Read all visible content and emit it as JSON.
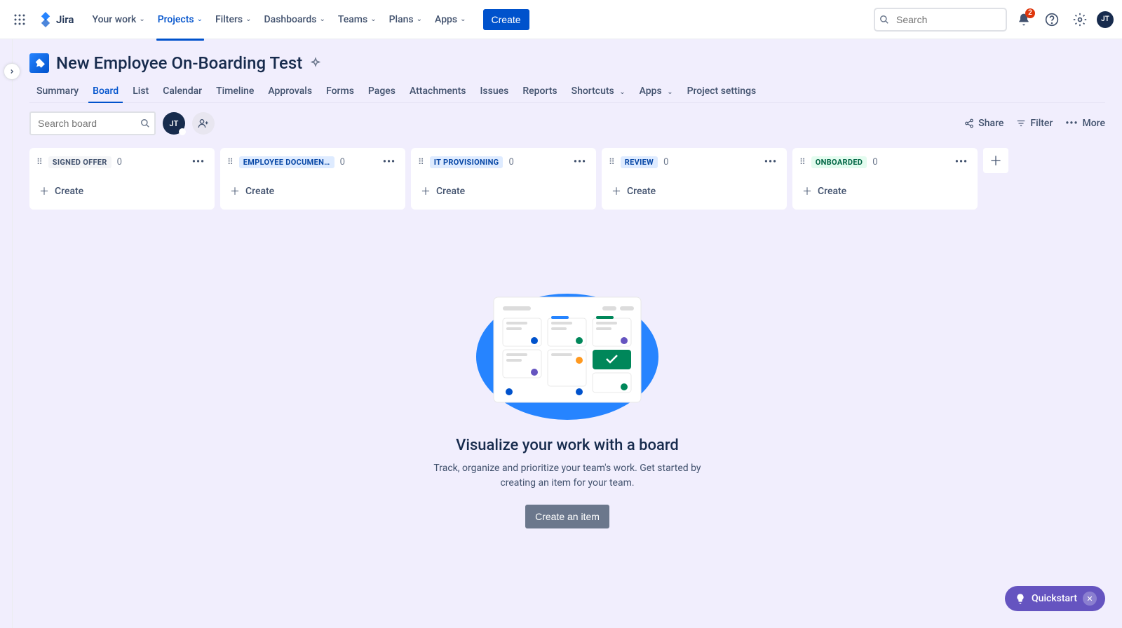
{
  "topnav": {
    "logo_text": "Jira",
    "items": [
      "Your work",
      "Projects",
      "Filters",
      "Dashboards",
      "Teams",
      "Plans",
      "Apps"
    ],
    "active_index": 1,
    "create_label": "Create",
    "search_placeholder": "Search",
    "notif_count": "2",
    "avatar_initials": "JT"
  },
  "project": {
    "title": "New Employee On-Boarding Test"
  },
  "tabs": {
    "items": [
      "Summary",
      "Board",
      "List",
      "Calendar",
      "Timeline",
      "Approvals",
      "Forms",
      "Pages",
      "Attachments",
      "Issues",
      "Reports",
      "Shortcuts",
      "Apps",
      "Project settings"
    ],
    "active_index": 1,
    "dropdown_indices": [
      11,
      12
    ]
  },
  "board_toolbar": {
    "search_placeholder": "Search board",
    "avatar_initials": "JT",
    "share_label": "Share",
    "filter_label": "Filter",
    "more_label": "More"
  },
  "columns": [
    {
      "name": "SIGNED OFFER",
      "count": "0",
      "style": "gray",
      "create_label": "Create"
    },
    {
      "name": "EMPLOYEE DOCUMEN…",
      "count": "0",
      "style": "blue",
      "create_label": "Create"
    },
    {
      "name": "IT PROVISIONING",
      "count": "0",
      "style": "blue",
      "create_label": "Create"
    },
    {
      "name": "REVIEW",
      "count": "0",
      "style": "blue",
      "create_label": "Create"
    },
    {
      "name": "ONBOARDED",
      "count": "0",
      "style": "green",
      "create_label": "Create"
    }
  ],
  "empty_state": {
    "title": "Visualize your work with a board",
    "description": "Track, organize and prioritize your team's work. Get started by creating an item for your team.",
    "button_label": "Create an item"
  },
  "quickstart": {
    "label": "Quickstart"
  }
}
